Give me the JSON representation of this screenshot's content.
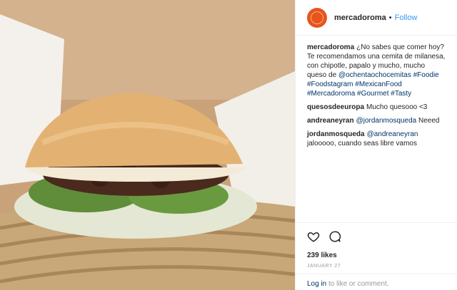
{
  "post": {
    "username": "mercadoroma",
    "follow_label": "Follow",
    "separator": "•"
  },
  "caption": {
    "user": "mercadoroma",
    "text_1": "¿No sabes que comer hoy? Te recomendamos una cemita de milanesa, con chipotle, papalo y mucho, mucho queso de ",
    "mention": "@ochentaochocemitas",
    "hashtags": "#Foodie #Foodstagram #MexicanFood #Mercadoroma #Gourmet #Tasty"
  },
  "comments": [
    {
      "user": "quesosdeeuropa",
      "text": "Mucho quesooo <3"
    },
    {
      "user": "andreaneyran",
      "mention": "@jordanmosqueda",
      "text": " Neeed"
    },
    {
      "user": "jordanmosqueda",
      "mention": "@andreaneyran",
      "text": " jalooooo, cuando seas libre vamos"
    }
  ],
  "likes": "239 likes",
  "date": "JANUARY 27",
  "login": {
    "link": "Log in",
    "rest": " to like or comment."
  },
  "icons": {
    "like": "heart-icon",
    "comment": "comment-icon"
  },
  "colors": {
    "follow": "#3897f0",
    "link": "#003569",
    "avatar": "#e8541c"
  }
}
